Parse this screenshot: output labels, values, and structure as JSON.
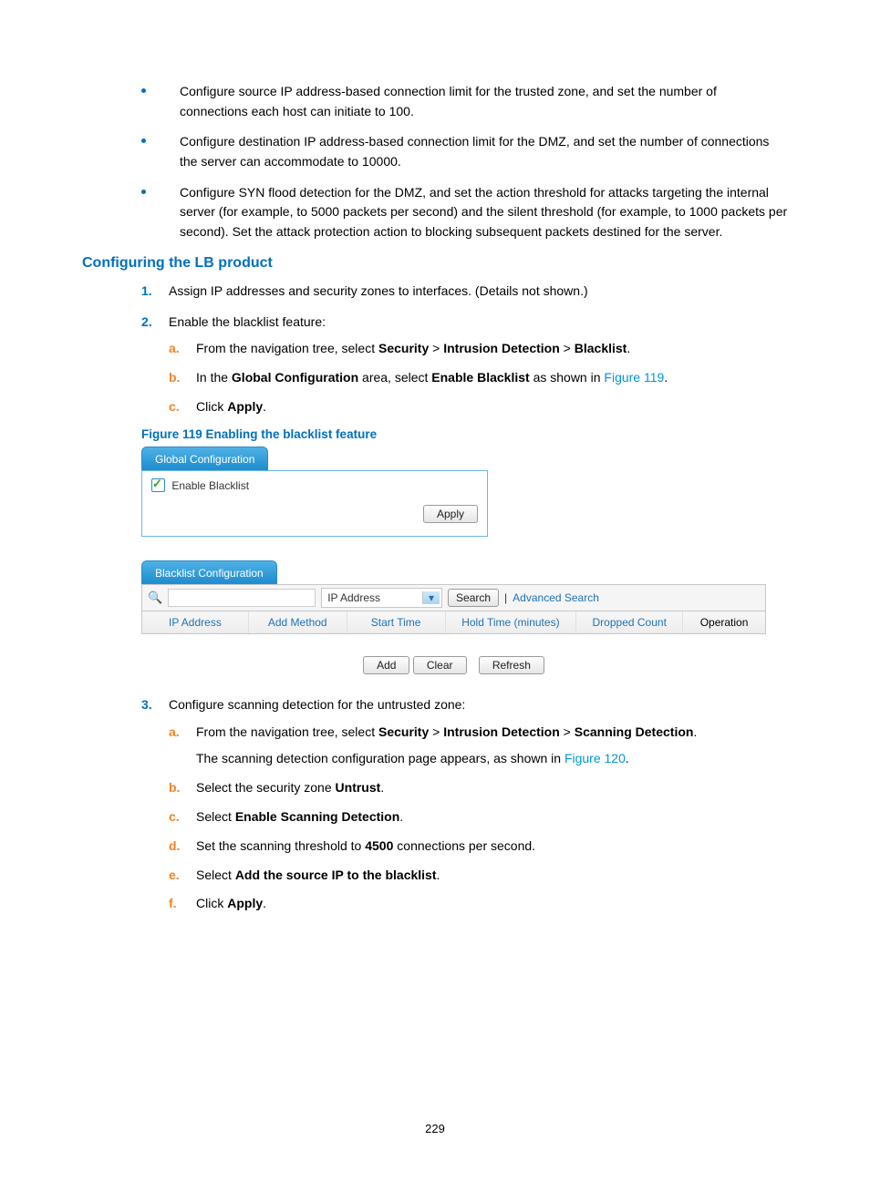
{
  "bullets": [
    "Configure source IP address-based connection limit for the trusted zone, and set the number of connections each host can initiate to 100.",
    "Configure destination IP address-based connection limit for the DMZ, and set the number of connections the server can accommodate to 10000.",
    "Configure SYN flood detection for the DMZ, and set the action threshold for attacks targeting the internal server (for example, to 5000 packets per second) and the silent threshold (for example, to 1000 packets per second). Set the attack protection action to blocking subsequent packets destined for the server."
  ],
  "heading": "Configuring the LB product",
  "step1": "Assign IP addresses and security zones to interfaces. (Details not shown.)",
  "step2": "Enable the blacklist feature:",
  "step2a": {
    "pre": "From the navigation tree, select ",
    "b1": "Security",
    "sep": " > ",
    "b2": "Intrusion Detection",
    "b3": "Blacklist",
    "end": "."
  },
  "step2b": {
    "pre": "In the ",
    "b1": "Global Configuration",
    "mid": " area, select ",
    "b2": "Enable Blacklist",
    "post": " as shown in ",
    "link": "Figure 119",
    "end": "."
  },
  "step2c": {
    "pre": "Click ",
    "b1": "Apply",
    "end": "."
  },
  "figcap": "Figure 119 Enabling the blacklist feature",
  "ui": {
    "tab1": "Global Configuration",
    "enable_bl": "Enable Blacklist",
    "apply": "Apply",
    "tab2": "Blacklist Configuration",
    "dd_label": "IP Address",
    "search": "Search",
    "adv": "Advanced Search",
    "cols": [
      "IP Address",
      "Add Method",
      "Start Time",
      "Hold Time (minutes)",
      "Dropped Count",
      "Operation"
    ],
    "add": "Add",
    "clear": "Clear",
    "refresh": "Refresh"
  },
  "step3": "Configure scanning detection for the untrusted zone:",
  "step3a": {
    "pre": "From the navigation tree, select ",
    "b1": "Security",
    "sep": " > ",
    "b2": "Intrusion Detection",
    "b3": "Scanning Detection",
    "end": ".",
    "line2pre": "The scanning detection configuration page appears, as shown in ",
    "link": "Figure 120",
    "line2end": "."
  },
  "step3b": {
    "pre": "Select the security zone ",
    "b1": "Untrust",
    "end": "."
  },
  "step3c": {
    "pre": "Select ",
    "b1": "Enable Scanning Detection",
    "end": "."
  },
  "step3d": {
    "pre": "Set the scanning threshold to ",
    "b1": "4500",
    "post": " connections per second."
  },
  "step3e": {
    "pre": "Select ",
    "b1": "Add the source IP to the blacklist",
    "end": "."
  },
  "step3f": {
    "pre": "Click ",
    "b1": "Apply",
    "end": "."
  },
  "pagenum": "229"
}
